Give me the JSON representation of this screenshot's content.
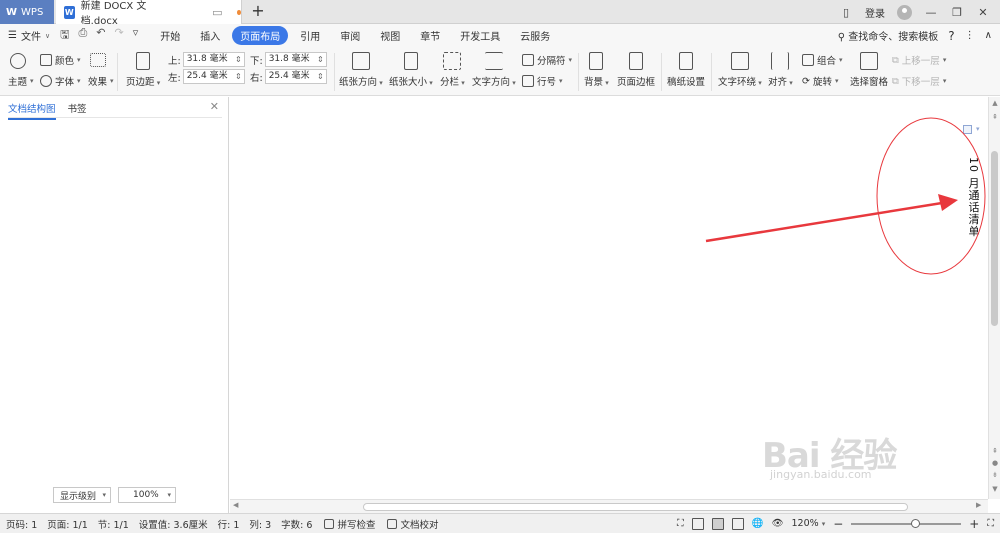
{
  "titlebar": {
    "app_tab": "WPS",
    "doc_tab": "新建 DOCX 文档.docx",
    "login": "登录"
  },
  "menu": {
    "file": "文件",
    "items": [
      "开始",
      "插入",
      "页面布局",
      "引用",
      "审阅",
      "视图",
      "章节",
      "开发工具",
      "云服务"
    ],
    "active": "页面布局",
    "search": "查找命令、搜索模板"
  },
  "ribbon": {
    "theme": "主题",
    "color": "颜色",
    "font": "字体",
    "effect": "效果",
    "margins": "页边距",
    "top_label": "上:",
    "top_value": "31.8 毫米",
    "bottom_label": "下:",
    "bottom_value": "31.8 毫米",
    "left_label": "左:",
    "left_value": "25.4 毫米",
    "right_label": "右:",
    "right_value": "25.4 毫米",
    "orientation": "纸张方向",
    "size": "纸张大小",
    "columns": "分栏",
    "text_direction": "文字方向",
    "separator": "分隔符",
    "line_numbers": "行号",
    "background": "背景",
    "page_border": "页面边框",
    "manuscript": "稿纸设置",
    "wrap": "文字环绕",
    "align": "对齐",
    "group": "组合",
    "rotate": "旋转",
    "selection_pane": "选择窗格",
    "bring_forward": "上移一层",
    "send_backward": "下移一层"
  },
  "leftpanel": {
    "tabs": [
      "文档结构图",
      "书签"
    ],
    "level_select": "显示级别",
    "zoom_select": "100%"
  },
  "document": {
    "vertical_text": "10 月通话清单"
  },
  "annotation": {
    "arrow_color": "#e8383d",
    "circle_color": "#e8383d"
  },
  "statusbar": {
    "page_num": "页码: 1",
    "pages": "页面: 1/1",
    "section": "节: 1/1",
    "setting": "设置值: 3.6厘米",
    "row": "行: 1",
    "col": "列: 3",
    "word_count": "字数: 6",
    "spell_check": "拼写检查",
    "doc_proof": "文档校对",
    "zoom": "120%"
  },
  "watermark": {
    "main": "Bai 经验",
    "sub": "jingyan.baidu.com"
  }
}
